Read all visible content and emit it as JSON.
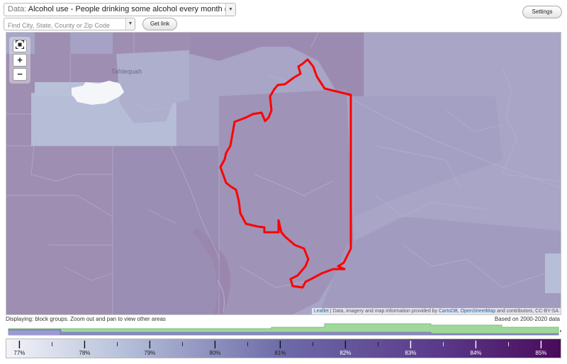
{
  "data_select": {
    "prefix": "Data:",
    "value": "Alcohol use - People drinking some alcohol every month (%)"
  },
  "search": {
    "placeholder": "Find City, State, County or Zip Code"
  },
  "buttons": {
    "get_link": "Get link",
    "settings": "Settings"
  },
  "map": {
    "place_label": "Tahlequah",
    "attribution": {
      "leaflet": "Leaflet",
      "middle": " | Data, imagery and map information provided by ",
      "carto": "CartoDB",
      "comma": ", ",
      "osm": "OpenStreetMap",
      "tail": " and contributors, CC-BY-SA"
    },
    "zoom": {
      "fit": "fit-bounds-icon",
      "in": "+",
      "out": "−"
    }
  },
  "footer": {
    "displaying": "Displaying: block groups. Zoom out and pan to view other areas",
    "based_on": "Based on 2000-2020 data"
  },
  "legend": {
    "labels": [
      "77%",
      "78%",
      "79%",
      "80%",
      "81%",
      "82%",
      "83%",
      "84%",
      "85%"
    ],
    "min": 76.8,
    "max": 85.3,
    "color_low": "#f3f3f8",
    "color_mid": "#6d6aa8",
    "color_high": "#4a0a5a"
  },
  "colors": {
    "boundary": "#ff0000",
    "histogram_green": "#8ed08e",
    "histogram_purple": "#8a86c2"
  }
}
